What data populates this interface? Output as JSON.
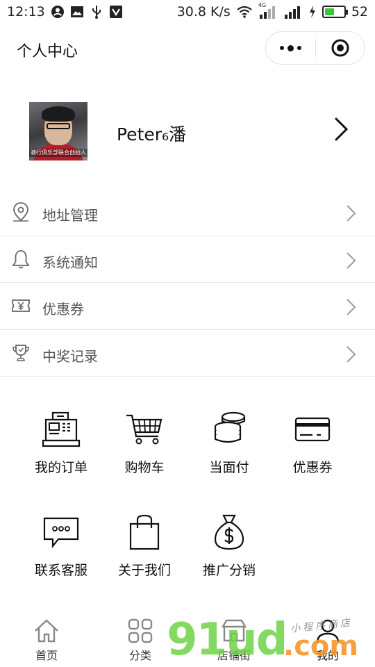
{
  "status_bar": {
    "time": "12:13",
    "network_speed": "30.8 K/s",
    "network_type": "4G",
    "battery_level": "52",
    "battery_fraction": 0.52,
    "battery_color": "#35c73a",
    "icons": [
      "account-circle-icon",
      "image-icon",
      "usb-icon",
      "vpn-shield-icon",
      "wifi-icon",
      "signal-4g-icon",
      "signal-icon",
      "charging-icon"
    ]
  },
  "title_bar": {
    "title": "个人中心",
    "capsule": {
      "more_icon": "more-dots-icon",
      "close_icon": "target-circle-icon"
    }
  },
  "profile": {
    "avatar_caption": "骑行俱乐部联合创始人",
    "nickname": "Peter₆潘",
    "arrow_icon": "chevron-right-icon"
  },
  "menu": [
    {
      "icon": "location-pin-icon",
      "label": "地址管理"
    },
    {
      "icon": "bell-icon",
      "label": "系统通知"
    },
    {
      "icon": "coupon-ticket-icon",
      "label": "优惠券"
    },
    {
      "icon": "trophy-icon",
      "label": "中奖记录"
    }
  ],
  "grid": [
    {
      "icon": "cash-register-icon",
      "label": "我的订单"
    },
    {
      "icon": "shopping-cart-icon",
      "label": "购物车"
    },
    {
      "icon": "coins-stack-icon",
      "label": "当面付"
    },
    {
      "icon": "card-icon",
      "label": "优惠券"
    },
    {
      "icon": "chat-bubble-icon",
      "label": "联系客服"
    },
    {
      "icon": "shopping-bag-icon",
      "label": "关于我们"
    },
    {
      "icon": "money-bag-icon",
      "label": "推广分销"
    }
  ],
  "tab_bar": [
    {
      "icon": "home-icon",
      "label": "首页"
    },
    {
      "icon": "category-grid-icon",
      "label": "分类"
    },
    {
      "icon": "store-icon",
      "label": "店铺街"
    },
    {
      "icon": "person-icon",
      "label": "我的"
    }
  ],
  "watermark": {
    "main": "91ud",
    "suffix": ".com",
    "small": "小程序商店"
  }
}
